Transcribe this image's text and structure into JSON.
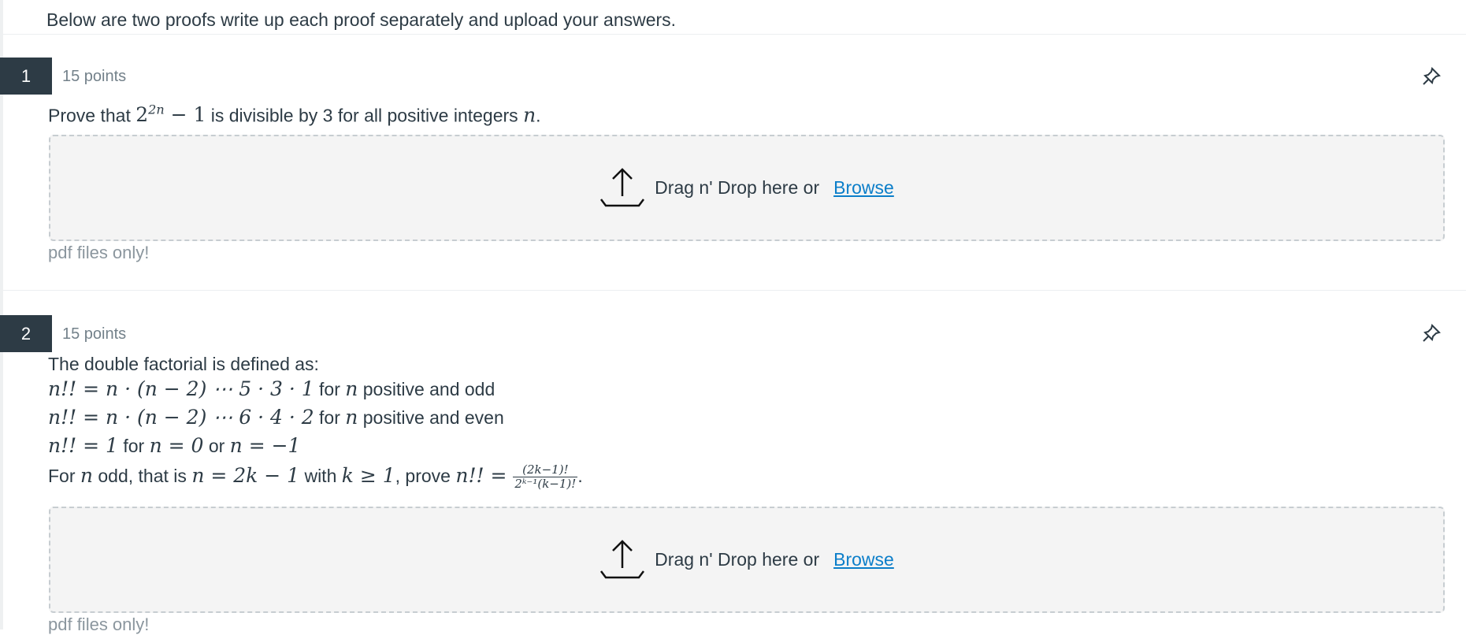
{
  "intro": "Below are two proofs write up each proof separately and upload your answers.",
  "questions": [
    {
      "number": "1",
      "points": "15 points",
      "prompt": {
        "pre": "Prove that ",
        "base": "2",
        "exp": "2n",
        "post_math": " − 1",
        "mid": " is divisible by 3 for all positive integers ",
        "var": "n",
        "end": "."
      },
      "upload": {
        "label": "Drag n' Drop here or",
        "browse": "Browse",
        "note": "pdf files only!"
      }
    },
    {
      "number": "2",
      "points": "15 points",
      "lines": {
        "l1": "The double factorial is defined as:",
        "l2_math": "n!! = n · (n − 2) ⋯ 5 · 3 · 1",
        "l2_t1": " for ",
        "l2_var": "n",
        "l2_t2": " positive and odd",
        "l3_math": "n!! = n · (n − 2) ⋯ 6 · 4 · 2",
        "l3_t1": " for ",
        "l3_var": "n",
        "l3_t2": " positive and even",
        "l4_math1": "n!! = 1",
        "l4_t1": " for ",
        "l4_math2": "n = 0",
        "l4_t2": " or ",
        "l4_math3": "n = −1",
        "l5_t1": "For ",
        "l5_var": "n",
        "l5_t2": " odd, that is ",
        "l5_math1": "n = 2k − 1",
        "l5_t3": " with ",
        "l5_math2": "k ≥ 1",
        "l5_t4": ", prove ",
        "l5_math3": "n!! = ",
        "frac_num": "(2k−1)!",
        "frac_den": "2ᵏ⁻¹(k−1)!",
        "l5_end": "."
      },
      "upload": {
        "label": "Drag n' Drop here or",
        "browse": "Browse",
        "note": "pdf files only!"
      }
    }
  ],
  "icons": {
    "pin": "pin-icon",
    "upload": "upload-arrow-icon"
  },
  "colors": {
    "qnum_bg": "#2d3b45",
    "link": "#0b7ec9",
    "dropzone_bg": "#f4f4f4"
  }
}
